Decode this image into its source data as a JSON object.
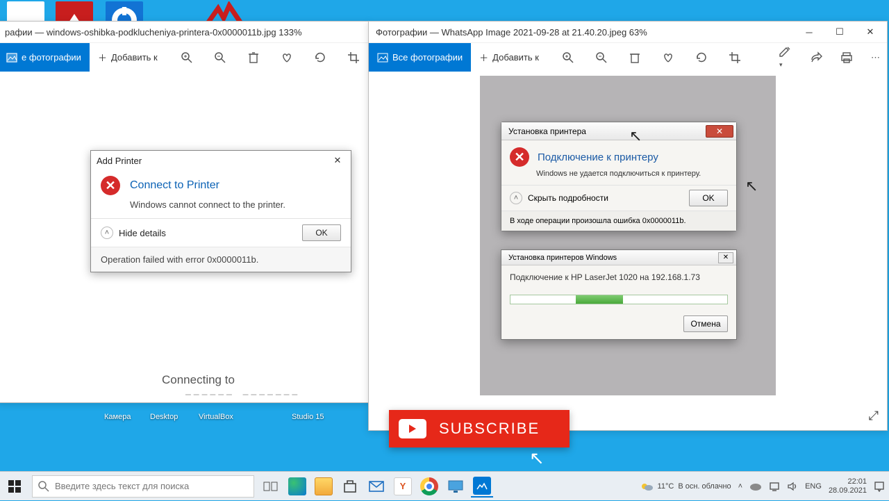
{
  "desktop": {
    "labels": [
      "Камера",
      "Desktop",
      "VirtualBox",
      "Studio 15"
    ]
  },
  "left_window": {
    "title": "рафии — windows-oshibka-podklucheniya-printera-0x0000011b.jpg   133%",
    "all_photos": "е фотографии",
    "add_to": "Добавить к"
  },
  "right_window": {
    "title": "Фотографии — WhatsApp Image 2021-09-28 at 21.40.20.jpeg   63%",
    "all_photos": "Все фотографии",
    "add_to": "Добавить к"
  },
  "addprinter": {
    "title": "Add Printer",
    "heading": "Connect to Printer",
    "msg": "Windows cannot connect to the printer.",
    "hide": "Hide details",
    "ok": "OK",
    "footer": "Operation failed with error 0x0000011b."
  },
  "connecting_text": "Connecting to",
  "ru_dialog": {
    "title": "Установка принтера",
    "heading": "Подключение к принтеру",
    "msg": "Windows не удается подключиться к принтеру.",
    "hide": "Скрыть подробности",
    "ok": "OK",
    "footer": "В ходе операции произошла ошибка 0x0000011b."
  },
  "install_dialog": {
    "title": "Установка принтеров Windows",
    "body": "Подключение к HP LaserJet 1020 на 192.168.1.73",
    "cancel": "Отмена"
  },
  "subscribe": "SUBSCRIBE",
  "taskbar": {
    "search_placeholder": "Введите здесь текст для поиска",
    "weather_temp": "11°C",
    "weather_text": "В осн. облачно",
    "lang": "ENG",
    "time": "22:01",
    "date": "28.09.2021"
  }
}
